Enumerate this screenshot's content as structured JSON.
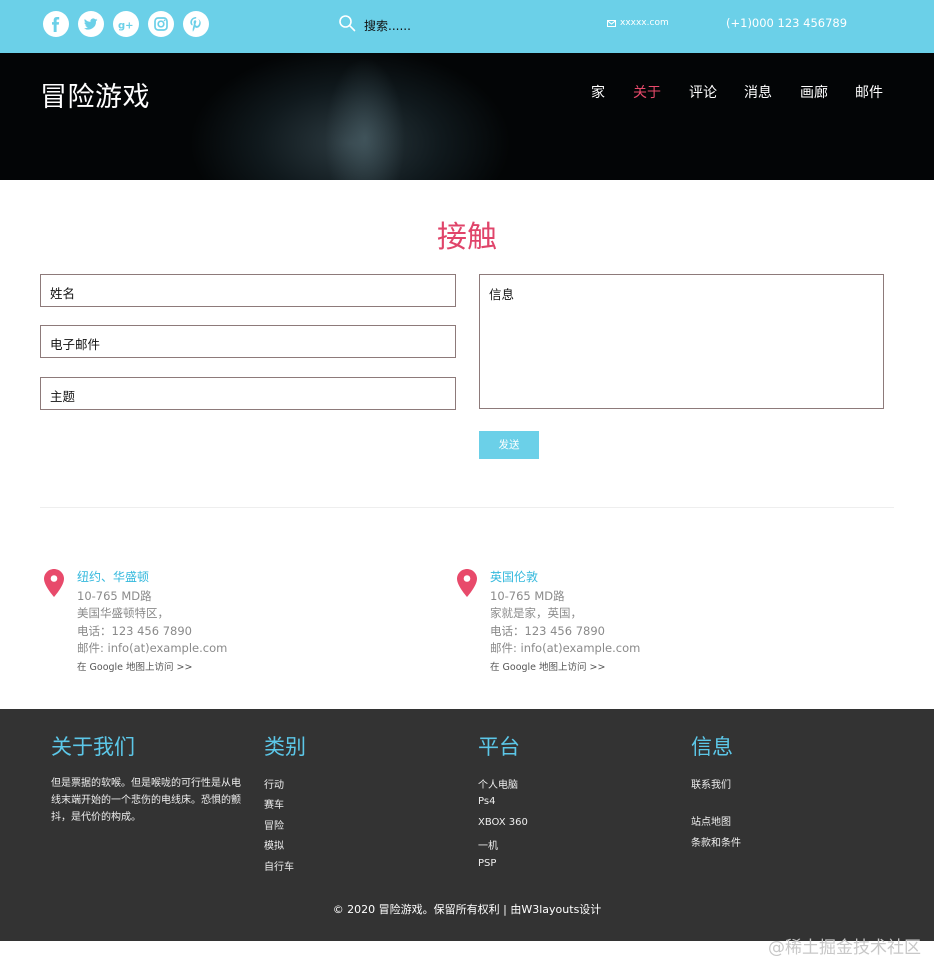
{
  "topbar": {
    "social_icons": [
      "facebook-icon",
      "twitter-icon",
      "google-plus-icon",
      "instagram-icon",
      "pinterest-icon"
    ],
    "search_placeholder": "搜索......",
    "email": "xxxxx.com",
    "phone": "(+1)000 123 456789"
  },
  "header": {
    "logo": "冒险游戏",
    "nav": [
      "家",
      "关于",
      "评论",
      "消息",
      "画廊",
      "邮件"
    ],
    "active_nav": "关于"
  },
  "contact": {
    "title": "接触",
    "name_placeholder": "姓名",
    "email_placeholder": "电子邮件",
    "subject_placeholder": "主题",
    "message_placeholder": "信息",
    "send_label": "发送"
  },
  "addresses": [
    {
      "city": "纽约、华盛顿",
      "line1": "10-765 MD路",
      "line2": "美国华盛顿特区，",
      "phone": "电话：123 456 7890",
      "email": "邮件: info(at)example.com",
      "map_link": "在 Google 地图上访问 >>"
    },
    {
      "city": "英国伦敦",
      "line1": "10-765 MD路",
      "line2": "家就是家，英国，",
      "phone": "电话：123 456 7890",
      "email": "邮件: info(at)example.com",
      "map_link": "在 Google 地图上访问 >>"
    }
  ],
  "footer": {
    "about": {
      "title": "关于我们",
      "text": "但是票据的软喉。但是喉咙的可行性是从电线末端开始的一个悲伤的电线床。恐惧的颤抖，是代价的构成。"
    },
    "categories": {
      "title": "类别",
      "items": [
        "行动",
        "赛车",
        "冒险",
        "模拟",
        "自行车"
      ]
    },
    "platforms": {
      "title": "平台",
      "items": [
        "个人电脑",
        "Ps4",
        "XBOX 360",
        "一机",
        "PSP"
      ]
    },
    "info": {
      "title": "信息",
      "items": [
        "联系我们",
        "站点地图",
        "条款和条件"
      ]
    },
    "copyright": "© 2020 冒险游戏。保留所有权利 | 由W3layouts设计"
  },
  "watermark": "@稀土掘金技术社区",
  "colors": {
    "accent": "#6bd0e8",
    "highlight": "#e84a6b",
    "footer_bg": "#333333",
    "footer_title": "#5cc7e8"
  }
}
